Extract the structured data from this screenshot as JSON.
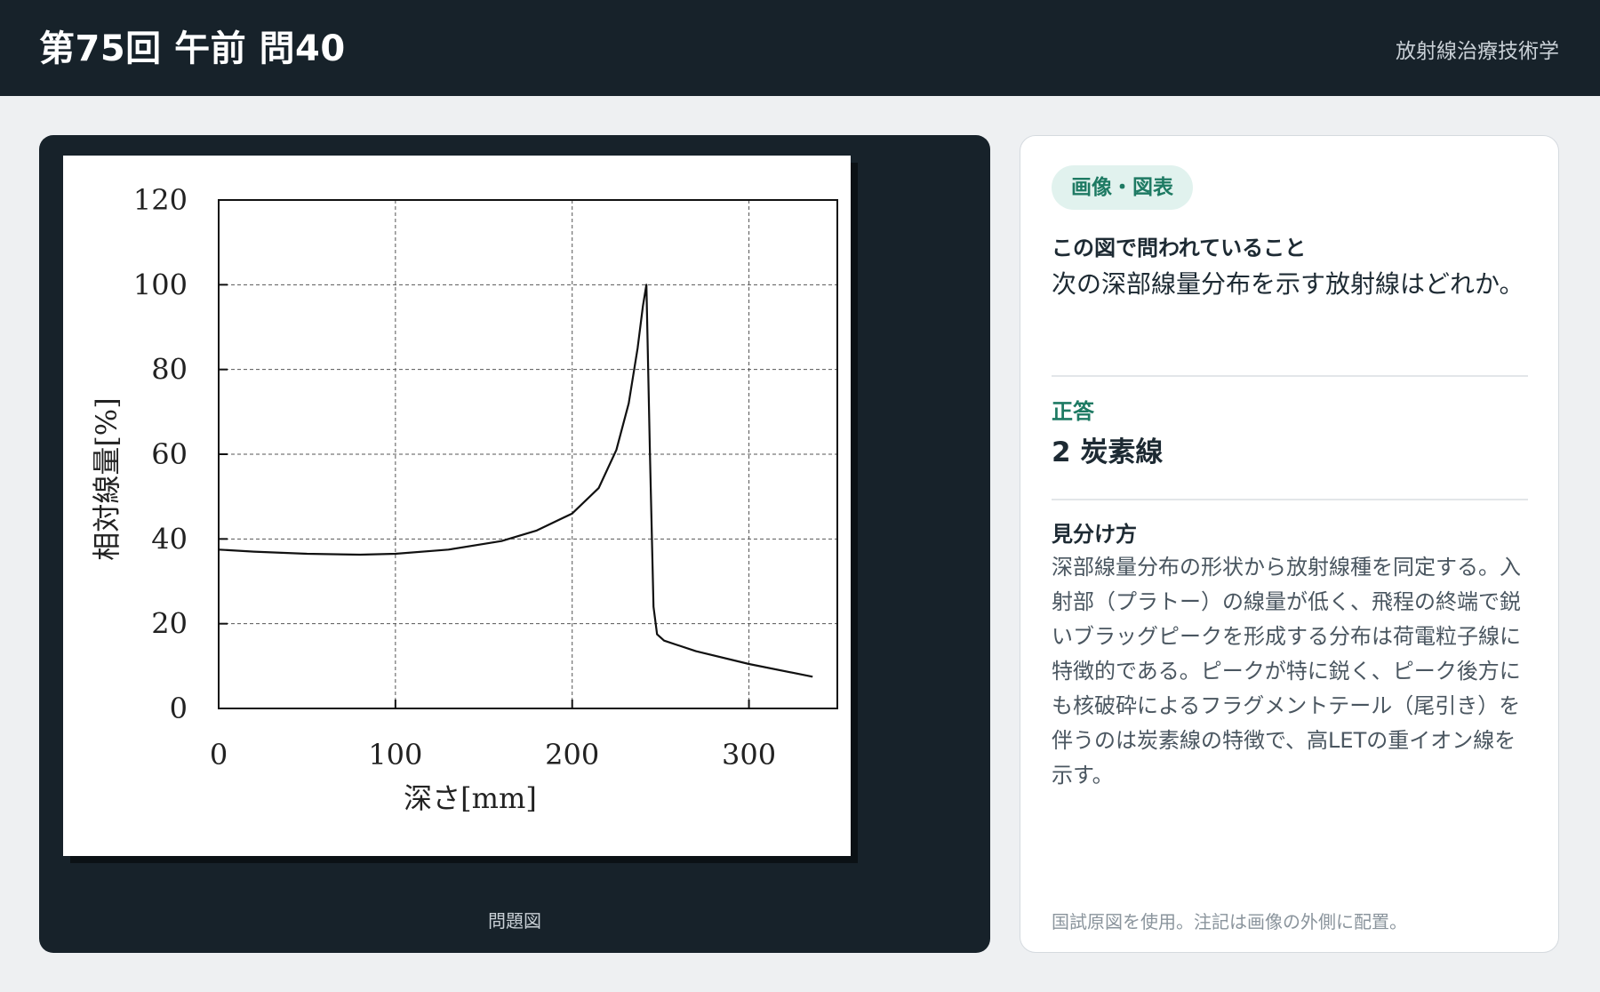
{
  "header": {
    "title": "第75回 午前 問40",
    "subject": "放射線治療技術学"
  },
  "figure": {
    "caption": "問題図"
  },
  "card": {
    "badge": "画像・図表",
    "question_label": "この図で問われていること",
    "question_text": "次の深部線量分布を示す放射線はどれか。",
    "answer_label": "正答",
    "answer": "2 炭素線",
    "explain_label": "見分け方",
    "explain_text": "深部線量分布の形状から放射線種を同定する。入射部（プラトー）の線量が低く、飛程の終端で鋭いブラッグピークを形成する分布は荷電粒子線に特徴的である。ピークが特に鋭く、ピーク後方にも核破砕によるフラグメントテール（尾引き）を伴うのは炭素線の特徴で、高LETの重イオン線を示す。",
    "footnote": "国試原図を使用。注記は画像の外側に配置。"
  },
  "chart_data": {
    "type": "line",
    "xlabel": "深さ[mm]",
    "ylabel": "相対線量[%]",
    "xlim": [
      0,
      350
    ],
    "ylim": [
      0,
      120
    ],
    "x_ticks": [
      0,
      100,
      200,
      300
    ],
    "y_ticks": [
      0,
      20,
      40,
      60,
      80,
      100,
      120
    ],
    "grid": true,
    "series": [
      {
        "x": [
          0,
          20,
          50,
          80,
          100,
          130,
          160,
          180,
          200,
          215,
          225,
          232,
          237,
          240,
          242,
          244,
          246,
          248,
          252,
          270,
          300,
          336
        ],
        "y": [
          37.5,
          37,
          36.5,
          36.3,
          36.5,
          37.5,
          39.5,
          42,
          46,
          52,
          61,
          72,
          85,
          95,
          100,
          60,
          24,
          17.5,
          16,
          13.5,
          10.5,
          7.5
        ]
      }
    ]
  }
}
